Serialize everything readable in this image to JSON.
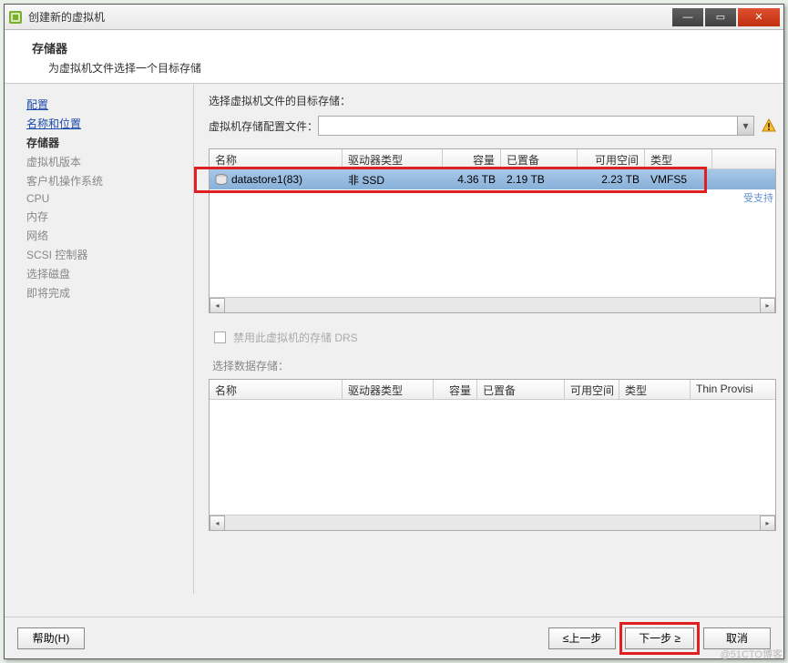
{
  "window": {
    "title": "创建新的虚拟机"
  },
  "header": {
    "title": "存储器",
    "subtitle": "为虚拟机文件选择一个目标存储"
  },
  "sidebar": {
    "items": [
      {
        "label": "配置",
        "type": "link"
      },
      {
        "label": "名称和位置",
        "type": "link"
      },
      {
        "label": "存储器",
        "type": "active"
      },
      {
        "label": "虚拟机版本",
        "type": "disabled"
      },
      {
        "label": "客户机操作系统",
        "type": "disabled"
      },
      {
        "label": "CPU",
        "type": "disabled"
      },
      {
        "label": "内存",
        "type": "disabled"
      },
      {
        "label": "网络",
        "type": "disabled"
      },
      {
        "label": "SCSI 控制器",
        "type": "disabled"
      },
      {
        "label": "选择磁盘",
        "type": "disabled"
      },
      {
        "label": "即将完成",
        "type": "disabled"
      }
    ]
  },
  "main": {
    "heading": "选择虚拟机文件的目标存储：",
    "profile_label": "虚拟机存储配置文件：",
    "columns": {
      "name": "名称",
      "drive_type": "驱动器类型",
      "capacity": "容量",
      "provisioned": "已置备",
      "free": "可用空间",
      "type": "类型",
      "thin": "Thin Provisi"
    },
    "rows": [
      {
        "name": "datastore1(83)",
        "drive_type": "非 SSD",
        "capacity": "4.36 TB",
        "provisioned": "2.19 TB",
        "free": "2.23 TB",
        "type": "VMFS5"
      }
    ],
    "supported_label": "受支持",
    "drs_checkbox": "禁用此虚拟机的存储 DRS",
    "datastore_label": "选择数据存储："
  },
  "footer": {
    "help": "帮助(H)",
    "back": "≤上一步",
    "next": "下一步 ≥",
    "cancel": "取消"
  },
  "watermark": "@51CTO博客"
}
